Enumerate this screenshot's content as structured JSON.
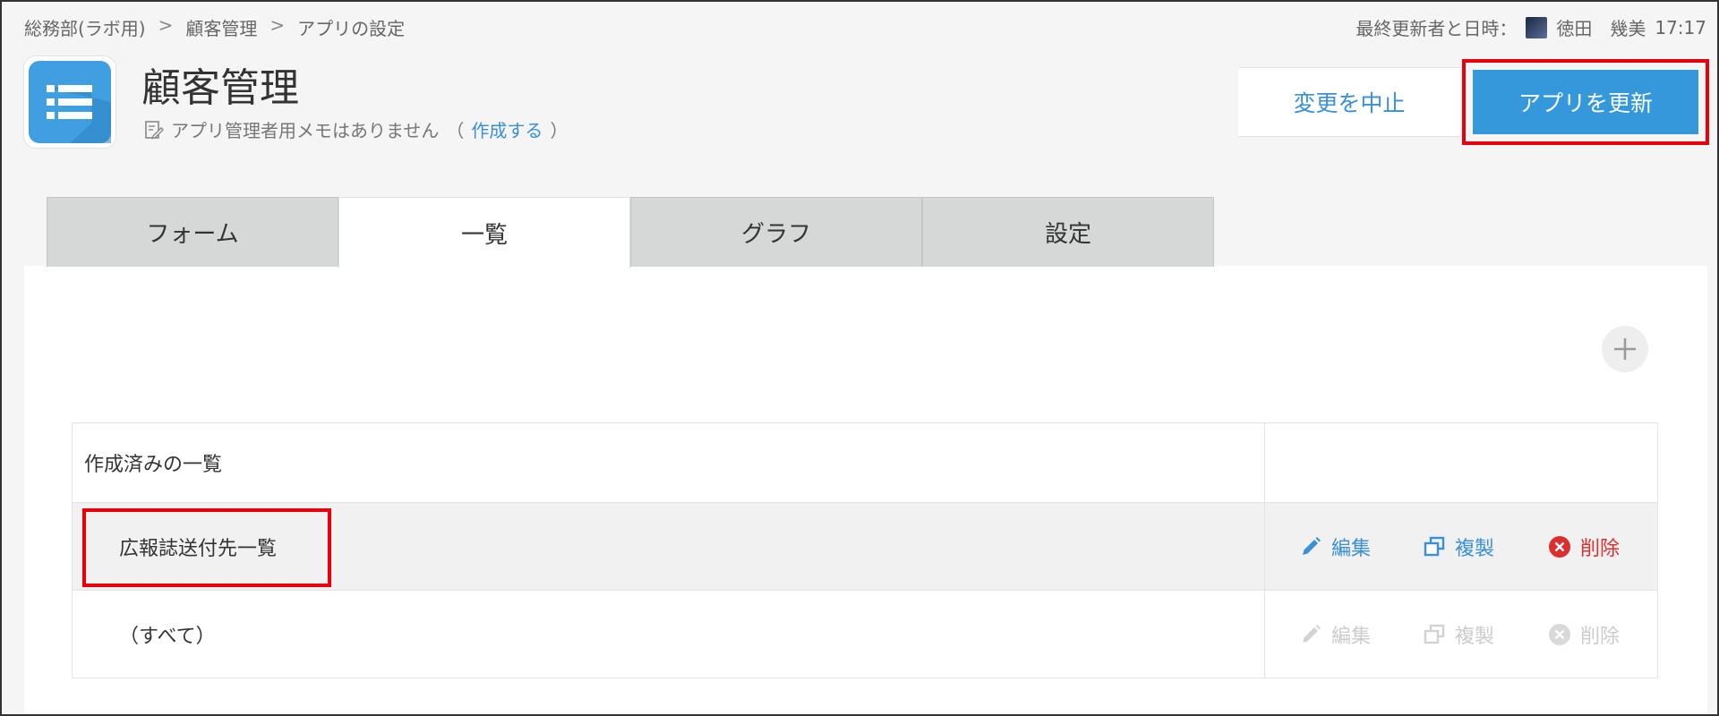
{
  "breadcrumb": {
    "items": [
      "総務部(ラボ用)",
      "顧客管理",
      "アプリの設定"
    ],
    "separator": ">"
  },
  "updated": {
    "label": "最終更新者と日時：",
    "user": "徳田　幾美",
    "time": "17:17"
  },
  "app": {
    "title": "顧客管理",
    "memo_text": "アプリ管理者用メモはありません",
    "memo_link": "作成する",
    "icon": "list-icon"
  },
  "header": {
    "cancel_label": "変更を中止",
    "update_label": "アプリを更新"
  },
  "tabs": [
    {
      "label": "フォーム",
      "active": false
    },
    {
      "label": "一覧",
      "active": true
    },
    {
      "label": "グラフ",
      "active": false
    },
    {
      "label": "設定",
      "active": false
    }
  ],
  "views": {
    "header": "作成済みの一覧",
    "rows": [
      {
        "name": "広報誌送付先一覧",
        "enabled": true
      },
      {
        "name": "（すべて）",
        "enabled": false
      }
    ],
    "actions": {
      "edit": "編集",
      "copy": "複製",
      "delete": "削除"
    }
  },
  "colors": {
    "accent": "#3498db",
    "link": "#3a8fd7",
    "danger": "#d9302f",
    "highlight_border": "#e8000b",
    "tab_inactive": "#d6d8d8",
    "disabled": "#cccccc"
  }
}
